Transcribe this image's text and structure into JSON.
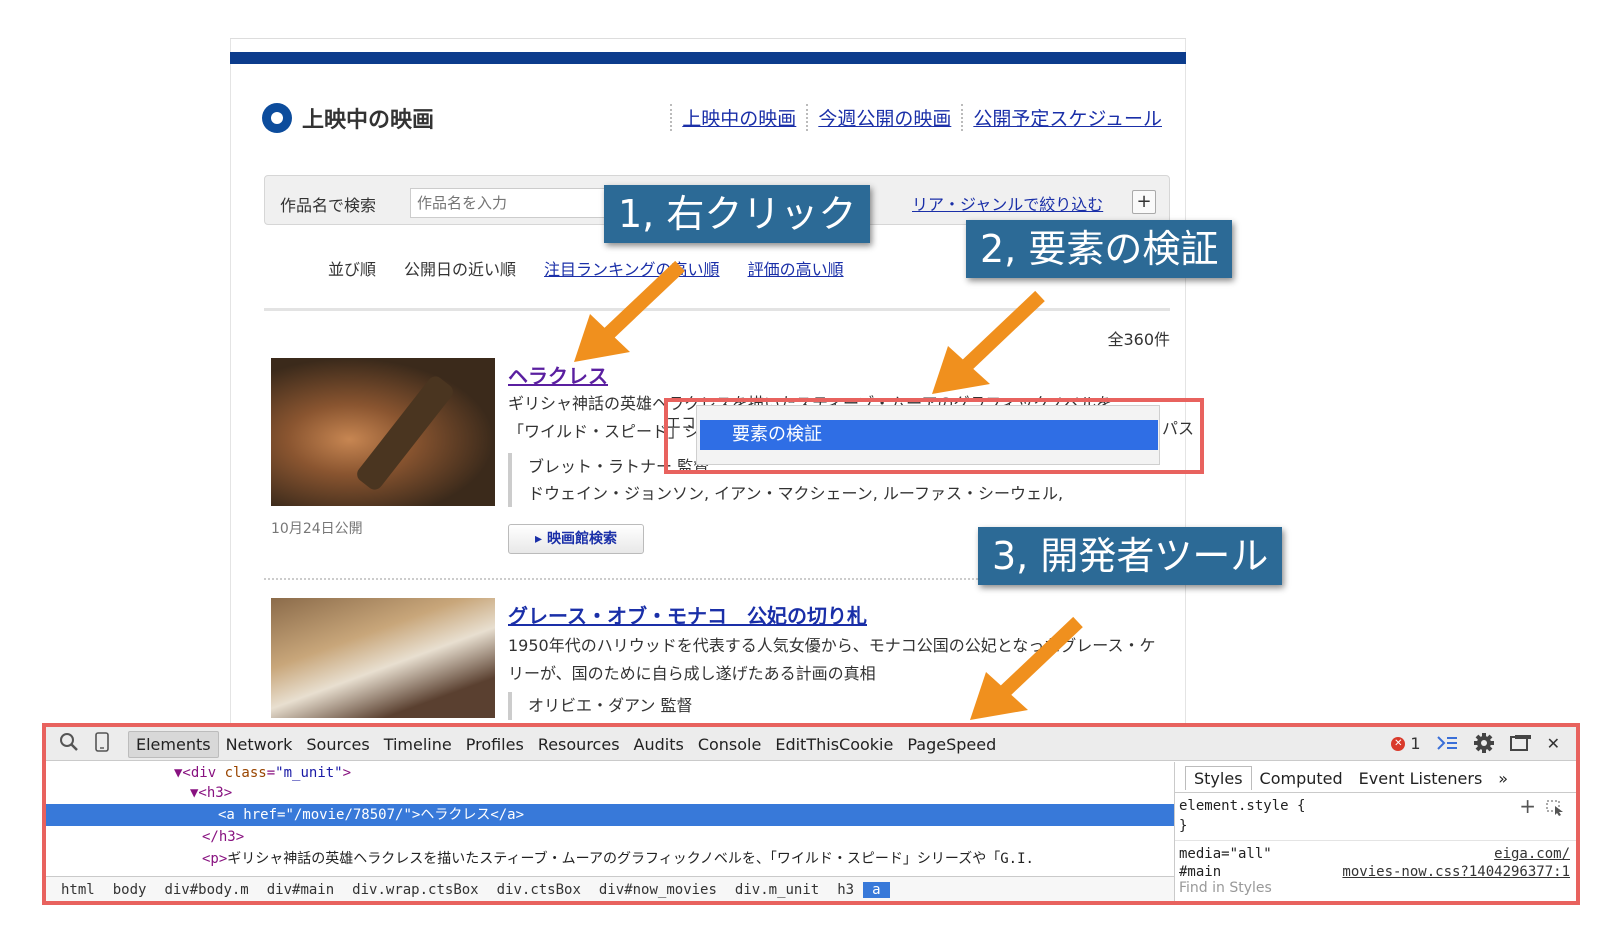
{
  "page": {
    "section_title": "上映中の映画",
    "top_links": [
      "上映中の映画",
      "今週公開の映画",
      "公開予定スケジュール"
    ],
    "search": {
      "label": "作品名で検索",
      "placeholder": "作品名を入力",
      "filter_link": "リア・ジャンルで絞り込む",
      "plus": "+"
    },
    "sort": {
      "label": "並び順",
      "current": "公開日の近い順",
      "options": [
        "注目ランキングの高い順",
        "評価の高い順"
      ]
    },
    "total": "全360件",
    "movies": [
      {
        "title": "ヘラクレス",
        "desc": "ギリシャ神話の英雄ヘラクレスを描いたスティーブ・ムーアのグラフィックノベルを、「ワイルド・スピード」シリーズや「G.I.",
        "credits": [
          "ブレット・ラトナー 監督",
          "ドウェイン・ジョンソン, イアン・マクシェーン, ルーファス・シーウェル,"
        ],
        "release": "10月24日公開",
        "theater_button": "▸ 映画館検索"
      },
      {
        "title": "グレース・オブ・モナコ　公妃の切り札",
        "desc": "1950年代のハリウッドを代表する人気女優から、モナコ公国の公妃となったグレース・ケリーが、国のために自ら成し遂げたある計画の真相",
        "credits": [
          "オリビエ・ダアン 監督"
        ]
      }
    ]
  },
  "context_menu": {
    "item": "要素の検証",
    "left_fragment": "エコ",
    "right_fragment": "パス"
  },
  "annotations": [
    "1, 右クリック",
    "2, 要素の検証",
    "3, 開発者ツール"
  ],
  "devtools": {
    "tabs": [
      "Elements",
      "Network",
      "Sources",
      "Timeline",
      "Profiles",
      "Resources",
      "Audits",
      "Console",
      "EditThisCookie",
      "PageSpeed"
    ],
    "active_tab": "Elements",
    "error_count": "1",
    "code_lines": [
      {
        "pre": "▼<div ",
        "attr": "class",
        "val": "\"m_unit\"",
        "post": ">"
      },
      {
        "pre": "▼<h3>",
        "attr": "",
        "val": "",
        "post": ""
      },
      {
        "pre": "<a ",
        "attr": "href",
        "val": "\"/movie/78507/\"",
        "post": ">ヘラクレス</a>"
      },
      {
        "pre": "</h3>",
        "attr": "",
        "val": "",
        "post": ""
      },
      {
        "pre": "<p>",
        "attr": "",
        "val": "",
        "post": "ギリシャ神話の英雄ヘラクレスを描いたスティーブ・ムーアのグラフィックノベルを、「ワイルド・スピード」シリーズや「G.I."
      }
    ],
    "breadcrumbs": [
      "html",
      "body",
      "div#body.m",
      "div#main",
      "div.wrap.ctsBox",
      "div.ctsBox",
      "div#now_movies",
      "div.m_unit",
      "h3",
      "a"
    ],
    "side_tabs": [
      "Styles",
      "Computed",
      "Event Listeners",
      "»"
    ],
    "styles": {
      "element_style": "element.style {",
      "close": "}",
      "media": "media=\"all\"",
      "media_source": "eiga.com/",
      "selector": "#main",
      "selector_source": "movies-now.css?1404296377:1",
      "filter_placeholder": "Find in Styles"
    }
  },
  "colors": {
    "accent": "#2c6a96",
    "highlight_box": "#e8625e",
    "arrow": "#f0901e",
    "selection": "#3879d9"
  }
}
